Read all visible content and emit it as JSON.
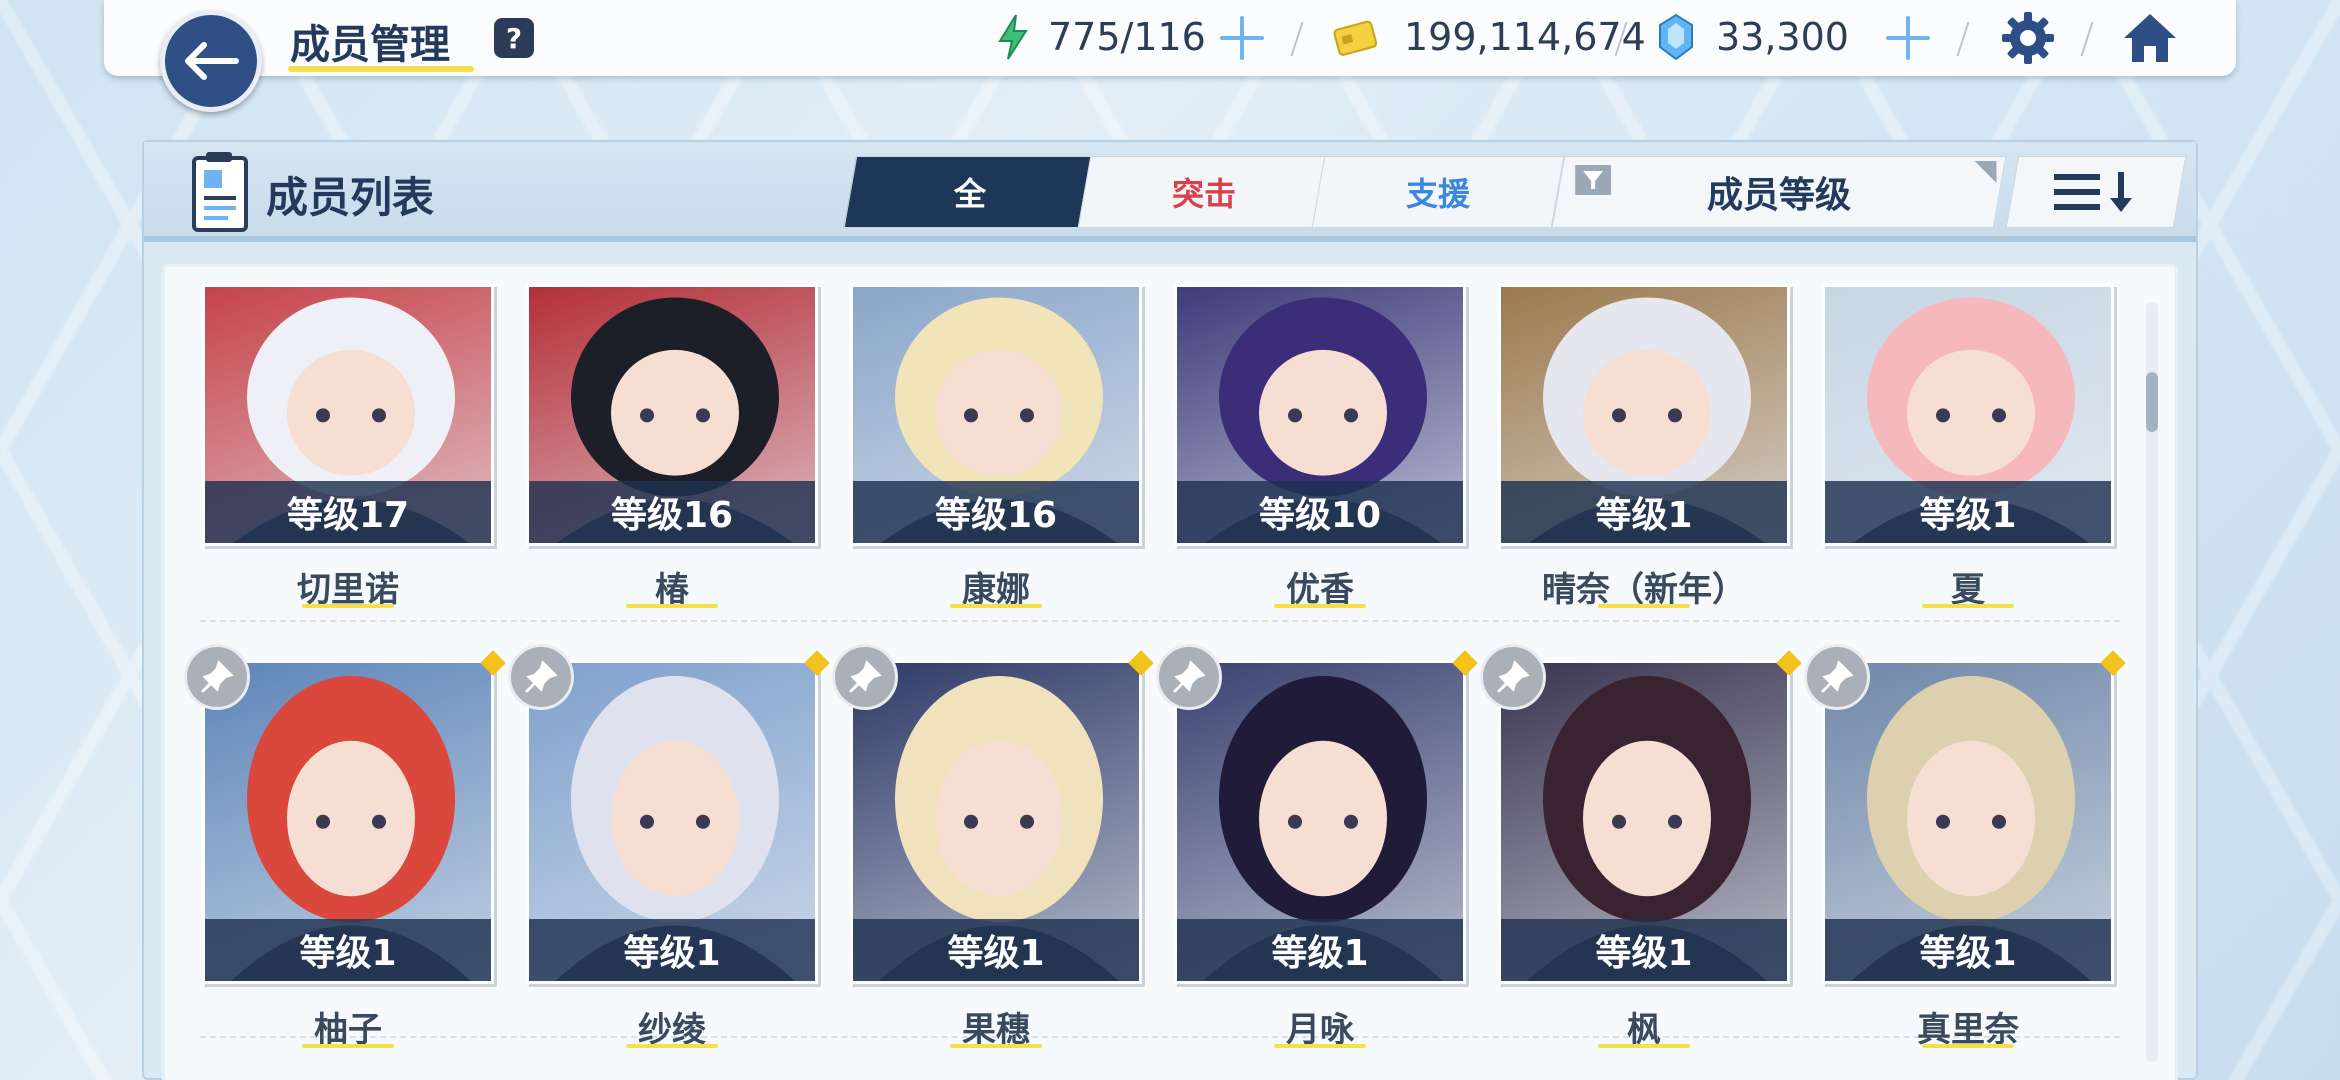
{
  "header": {
    "title": "成员管理",
    "help_label": "?",
    "resources": {
      "stamina": "775/116",
      "credits": "199,114,674",
      "gems": "33,300"
    }
  },
  "panel": {
    "title": "成员列表",
    "tabs": [
      {
        "label": "全",
        "active": true,
        "color": "#ffffff"
      },
      {
        "label": "突击",
        "active": false,
        "color": "#d8404a"
      },
      {
        "label": "支援",
        "active": false,
        "color": "#3a86e0"
      }
    ],
    "sort_label": "成员等级"
  },
  "rows": [
    {
      "cards": [
        {
          "name": "切里诺",
          "level": "等级17",
          "bg": "#c6434a",
          "hair": "#eef0f5",
          "pinned": false
        },
        {
          "name": "椿",
          "level": "等级16",
          "bg": "#b52f38",
          "hair": "#1c1e28",
          "pinned": false
        },
        {
          "name": "康娜",
          "level": "等级16",
          "bg": "#8aa6c9",
          "hair": "#f1e4b8",
          "pinned": false
        },
        {
          "name": "优香",
          "level": "等级10",
          "bg": "#3e3c7a",
          "hair": "#3b2d78",
          "pinned": false
        },
        {
          "name": "晴奈（新年）",
          "level": "等级1",
          "bg": "#9c7a4d",
          "hair": "#e6e6ee",
          "pinned": false
        },
        {
          "name": "夏",
          "level": "等级1",
          "bg": "#c7d6e4",
          "hair": "#f5b9bd",
          "pinned": false
        }
      ]
    },
    {
      "cards": [
        {
          "name": "柚子",
          "level": "等级1",
          "bg": "#5e85b8",
          "hair": "#d9473d",
          "pinned": true
        },
        {
          "name": "纱绫",
          "level": "等级1",
          "bg": "#7fa0cc",
          "hair": "#dfe2ee",
          "pinned": true
        },
        {
          "name": "果穗",
          "level": "等级1",
          "bg": "#2f3a66",
          "hair": "#f0e2bd",
          "pinned": true
        },
        {
          "name": "月咏",
          "level": "等级1",
          "bg": "#3a4270",
          "hair": "#1f1b38",
          "pinned": true
        },
        {
          "name": "枫",
          "level": "等级1",
          "bg": "#3a3550",
          "hair": "#3a2330",
          "pinned": true
        },
        {
          "name": "真里奈",
          "level": "等级1",
          "bg": "#6f87a8",
          "hair": "#dcd0ae",
          "pinned": true
        }
      ]
    }
  ],
  "colors": {
    "accent_yellow": "#f5df4d",
    "navy": "#1e3658",
    "back_button": "#2f4f86"
  }
}
